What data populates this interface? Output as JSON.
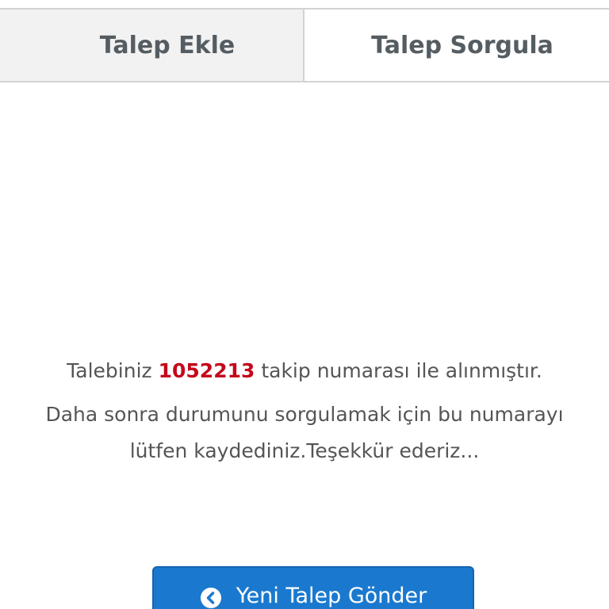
{
  "tabs": [
    {
      "label": "Talep Ekle"
    },
    {
      "label": "Talep Sorgula"
    }
  ],
  "message": {
    "prefix": "Talebiniz",
    "tracking_number": "1052213",
    "suffix": "takip numarası ile alınmıştır.",
    "note": "Daha sonra durumunu sorgulamak için bu numarayı lütfen kaydediniz.Teşekkür ederiz..."
  },
  "button": {
    "label": "Yeni Talep Gönder",
    "icon": "chevron-left-circle-icon"
  },
  "colors": {
    "tracking_number": "#c4081c",
    "button_bg": "#1a79cf",
    "tab_text": "#555d62",
    "inactive_tab_bg": "#f2f2f2"
  }
}
